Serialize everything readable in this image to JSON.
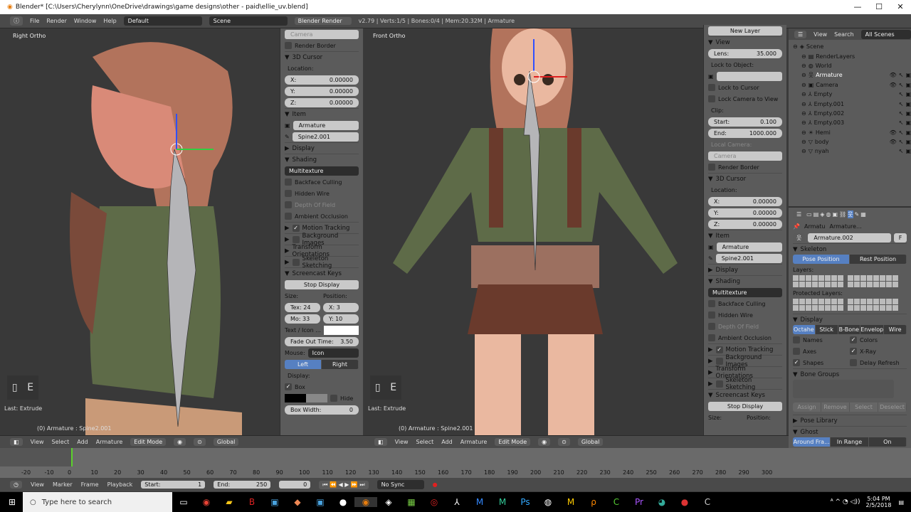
{
  "title": "Blender* [C:\\Users\\Cherylynn\\OneDrive\\drawings\\game designs\\other - paid\\ellie_uv.blend]",
  "window_controls": [
    "—",
    "☐",
    "✕"
  ],
  "menu": [
    "File",
    "Render",
    "Window",
    "Help"
  ],
  "layout": "Default",
  "scene": "Scene",
  "engine": "Blender Render",
  "stats": "v2.79 | Verts:1/5 | Bones:0/4 | Mem:20.32M | Armature",
  "left_view": {
    "label": "Right Ortho",
    "key": "E",
    "last_op": "Last: Extrude",
    "status": "(0) Armature : Spine2.001"
  },
  "right_view": {
    "label": "Front Ortho",
    "key": "E",
    "last_op": "Last: Extrude",
    "status": "(0) Armature : Spine2.001"
  },
  "left_panel": [
    {
      "t": "text",
      "label": "Camera",
      "dim": true
    },
    {
      "t": "check",
      "label": "Render Border"
    },
    {
      "t": "hd",
      "label": "3D Cursor",
      "open": true
    },
    {
      "t": "label",
      "label": "Location:"
    },
    {
      "t": "field",
      "label": "X:",
      "value": "0.00000"
    },
    {
      "t": "field",
      "label": "Y:",
      "value": "0.00000"
    },
    {
      "t": "field",
      "label": "Z:",
      "value": "0.00000"
    },
    {
      "t": "hd",
      "label": "Item",
      "open": true
    },
    {
      "t": "text",
      "label": "Armature",
      "icon": "▣"
    },
    {
      "t": "text",
      "label": "Spine2.001",
      "icon": "✎"
    },
    {
      "t": "hd",
      "label": "Display",
      "open": false
    },
    {
      "t": "hd",
      "label": "Shading",
      "open": true
    },
    {
      "t": "select",
      "label": "Multitexture"
    },
    {
      "t": "check",
      "label": "Backface Culling"
    },
    {
      "t": "check",
      "label": "Hidden Wire"
    },
    {
      "t": "check",
      "label": "Depth Of Field",
      "dim": true
    },
    {
      "t": "check",
      "label": "Ambient Occlusion"
    },
    {
      "t": "hd",
      "label": "Motion Tracking",
      "open": false,
      "cb": true,
      "checked": true
    },
    {
      "t": "hd",
      "label": "Background Images",
      "open": false,
      "cb": true
    },
    {
      "t": "hd",
      "label": "Transform Orientations",
      "open": false
    },
    {
      "t": "hd",
      "label": "Skeleton Sketching",
      "open": false,
      "cb": true
    },
    {
      "t": "hd",
      "label": "Screencast Keys",
      "open": true
    },
    {
      "t": "button",
      "label": "Stop Display"
    },
    {
      "t": "pair",
      "a": "Size:",
      "b": "Position:"
    },
    {
      "t": "pairf",
      "a": "Tex: 24",
      "b": "X: 3"
    },
    {
      "t": "pairf",
      "a": "Mo: 33",
      "b": "Y: 10"
    },
    {
      "t": "color",
      "label": "Text / Icon ..."
    },
    {
      "t": "field",
      "label": "Fade Out Time:",
      "value": "3.50"
    },
    {
      "t": "selectl",
      "label": "Mouse:",
      "value": "Icon"
    },
    {
      "t": "seg",
      "a": "Left",
      "b": "Right"
    },
    {
      "t": "label",
      "label": "Display:"
    },
    {
      "t": "check",
      "label": "Box",
      "checked": true
    },
    {
      "t": "hide",
      "label": "Hide"
    },
    {
      "t": "field",
      "label": "Box Width:",
      "value": "0"
    }
  ],
  "right_panel": [
    {
      "t": "button",
      "label": "New Layer"
    },
    {
      "t": "hd",
      "label": "View",
      "open": true
    },
    {
      "t": "field",
      "label": "Lens:",
      "value": "35.000"
    },
    {
      "t": "label",
      "label": "Lock to Object:"
    },
    {
      "t": "text",
      "label": "",
      "icon": "▣"
    },
    {
      "t": "check",
      "label": "Lock to Cursor"
    },
    {
      "t": "check",
      "label": "Lock Camera to View"
    },
    {
      "t": "label",
      "label": "Clip:"
    },
    {
      "t": "field",
      "label": "Start:",
      "value": "0.100"
    },
    {
      "t": "field",
      "label": "End:",
      "value": "1000.000"
    },
    {
      "t": "label",
      "label": "Local Camera:",
      "dim": true
    },
    {
      "t": "text",
      "label": "Camera",
      "dim": true
    },
    {
      "t": "check",
      "label": "Render Border"
    },
    {
      "t": "hd",
      "label": "3D Cursor",
      "open": true
    },
    {
      "t": "label",
      "label": "Location:"
    },
    {
      "t": "field",
      "label": "X:",
      "value": "0.00000"
    },
    {
      "t": "field",
      "label": "Y:",
      "value": "0.00000"
    },
    {
      "t": "field",
      "label": "Z:",
      "value": "0.00000"
    },
    {
      "t": "hd",
      "label": "Item",
      "open": true
    },
    {
      "t": "text",
      "label": "Armature",
      "icon": "▣"
    },
    {
      "t": "text",
      "label": "Spine2.001",
      "icon": "✎"
    },
    {
      "t": "hd",
      "label": "Display",
      "open": false
    },
    {
      "t": "hd",
      "label": "Shading",
      "open": true
    },
    {
      "t": "select",
      "label": "Multitexture"
    },
    {
      "t": "check",
      "label": "Backface Culling"
    },
    {
      "t": "check",
      "label": "Hidden Wire"
    },
    {
      "t": "check",
      "label": "Depth Of Field",
      "dim": true
    },
    {
      "t": "check",
      "label": "Ambient Occlusion"
    },
    {
      "t": "hd",
      "label": "Motion Tracking",
      "open": false,
      "cb": true,
      "checked": true
    },
    {
      "t": "hd",
      "label": "Background Images",
      "open": false,
      "cb": true
    },
    {
      "t": "hd",
      "label": "Transform Orientations",
      "open": false
    },
    {
      "t": "hd",
      "label": "Skeleton Sketching",
      "open": false,
      "cb": true
    },
    {
      "t": "hd",
      "label": "Screencast Keys",
      "open": true
    },
    {
      "t": "button",
      "label": "Stop Display"
    },
    {
      "t": "pair",
      "a": "Size:",
      "b": "Position:"
    }
  ],
  "viewport_header": {
    "items": [
      "View",
      "Select",
      "Add",
      "Armature"
    ],
    "mode": "Edit Mode",
    "orientation": "Global"
  },
  "outliner": {
    "header": [
      "View",
      "Search",
      "All Scenes"
    ],
    "items": [
      {
        "name": "Scene",
        "icon": "◈",
        "indent": 0
      },
      {
        "name": "RenderLayers",
        "icon": "▤",
        "indent": 1
      },
      {
        "name": "World",
        "icon": "◍",
        "indent": 1
      },
      {
        "name": "Armature",
        "icon": "웃",
        "indent": 1,
        "eye": true,
        "selected": true
      },
      {
        "name": "Camera",
        "icon": "▣",
        "indent": 1,
        "eye": true
      },
      {
        "name": "Empty",
        "icon": "⅄",
        "indent": 1
      },
      {
        "name": "Empty.001",
        "icon": "⅄",
        "indent": 1
      },
      {
        "name": "Empty.002",
        "icon": "⅄",
        "indent": 1
      },
      {
        "name": "Empty.003",
        "icon": "⅄",
        "indent": 1
      },
      {
        "name": "Hemi",
        "icon": "☀",
        "indent": 1,
        "eye": true
      },
      {
        "name": "body",
        "icon": "▽",
        "indent": 1,
        "eye": true
      },
      {
        "name": "nyah",
        "icon": "▽",
        "indent": 1
      }
    ]
  },
  "properties": {
    "breadcrumb": [
      "Armatu",
      "Armature..."
    ],
    "datablock": "Armature.002",
    "fake": "F",
    "skeleton": {
      "title": "Skeleton",
      "pose": "Pose Position",
      "rest": "Rest Position",
      "layers": "Layers:",
      "protected": "Protected Layers:"
    },
    "display": {
      "title": "Display",
      "modes": [
        "Octahe",
        "Stick",
        "B-Bone",
        "Envelop",
        "Wire"
      ],
      "checks": [
        {
          "label": "Names",
          "checked": false
        },
        {
          "label": "Colors",
          "checked": true
        },
        {
          "label": "Axes",
          "checked": false
        },
        {
          "label": "X-Ray",
          "checked": true
        },
        {
          "label": "Shapes",
          "checked": true
        },
        {
          "label": "Delay Refresh",
          "checked": false
        }
      ]
    },
    "bone_groups": {
      "title": "Bone Groups",
      "buttons": [
        "Assign",
        "Remove",
        "Select",
        "Deselect"
      ]
    },
    "pose_library": "Pose Library",
    "ghost": {
      "title": "Ghost",
      "modes": [
        "Around Fra...",
        "In Range",
        "On Keyframes"
      ]
    }
  },
  "timeline": {
    "ticks": [
      "-20",
      "-10",
      "0",
      "10",
      "20",
      "30",
      "40",
      "50",
      "60",
      "70",
      "80",
      "90",
      "100",
      "110",
      "120",
      "130",
      "140",
      "150",
      "160",
      "170",
      "180",
      "190",
      "200",
      "210",
      "220",
      "230",
      "240",
      "250",
      "260",
      "270",
      "280",
      "290",
      "300"
    ],
    "menu": [
      "View",
      "Marker",
      "Frame",
      "Playback"
    ],
    "start_label": "Start:",
    "start": "1",
    "end_label": "End:",
    "end": "250",
    "current": "0",
    "sync": "No Sync"
  },
  "taskbar": {
    "search": "Type here to search",
    "time": "5:04 PM",
    "date": "2/5/2018"
  },
  "colors": {
    "accent": "#5680c2",
    "viewport": "#393939",
    "panel": "#5b5b5b"
  }
}
